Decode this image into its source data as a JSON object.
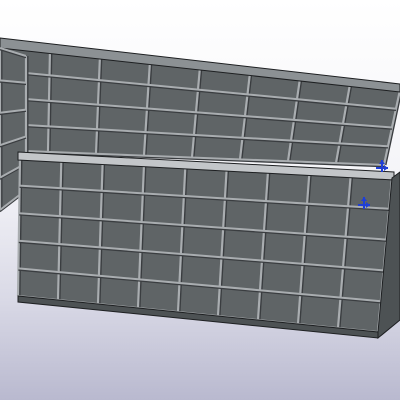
{
  "viewport": {
    "label": "",
    "background_top": "#ffffff",
    "background_bottom": "#b9b9cf"
  },
  "model": {
    "name": "",
    "panel_color": "#5f6466",
    "panel_color_dark": "#4d5254",
    "rib_color": "#a9adb0",
    "rib_shadow": "#3a3d40",
    "edge_color": "#1d1f21"
  },
  "markers": [
    {
      "icon": "triad-axis-icon",
      "color": "#1f3fd6"
    },
    {
      "icon": "triad-axis-icon",
      "color": "#1f3fd6"
    }
  ]
}
